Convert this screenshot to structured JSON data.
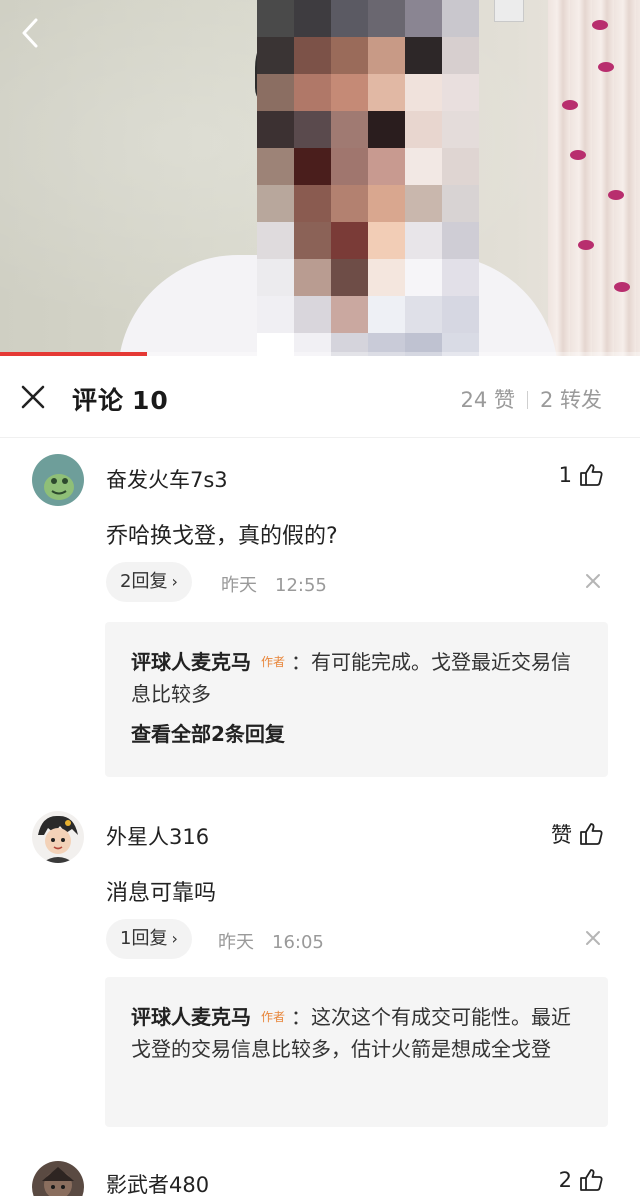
{
  "video": {
    "progress_fraction": 0.23
  },
  "icons": {
    "back": "chevron-left-icon",
    "close": "close-icon",
    "like": "thumbs-up-icon",
    "dismiss": "dismiss-icon"
  },
  "colors": {
    "progress_accent": "#e53935",
    "author_tag": "#e8863a",
    "muted_text": "#9a9a9a"
  },
  "header": {
    "title": "评论",
    "comment_count": "10",
    "likes": "24 赞",
    "shares": "2 转发"
  },
  "comments": [
    {
      "username": "奋发火车7s3",
      "like_label": "1",
      "text": "乔哈换戈登，真的假的?",
      "reply_count_label": "2回复",
      "date": "昨天",
      "time": "12:55",
      "author_reply": {
        "author": "评球人麦克马",
        "tag": "作者",
        "text": "：有可能完成。戈登最近交易信息比较多",
        "view_all": "查看全部2条回复"
      }
    },
    {
      "username": "外星人316",
      "like_label": "赞",
      "text": "消息可靠吗",
      "reply_count_label": "1回复",
      "date": "昨天",
      "time": "16:05",
      "author_reply": {
        "author": "评球人麦克马",
        "tag": "作者",
        "text": "：这次这个有成交可能性。最近戈登的交易信息比较多，估计火箭是想成全戈登"
      }
    },
    {
      "username": "影武者480",
      "like_label": "2"
    }
  ]
}
